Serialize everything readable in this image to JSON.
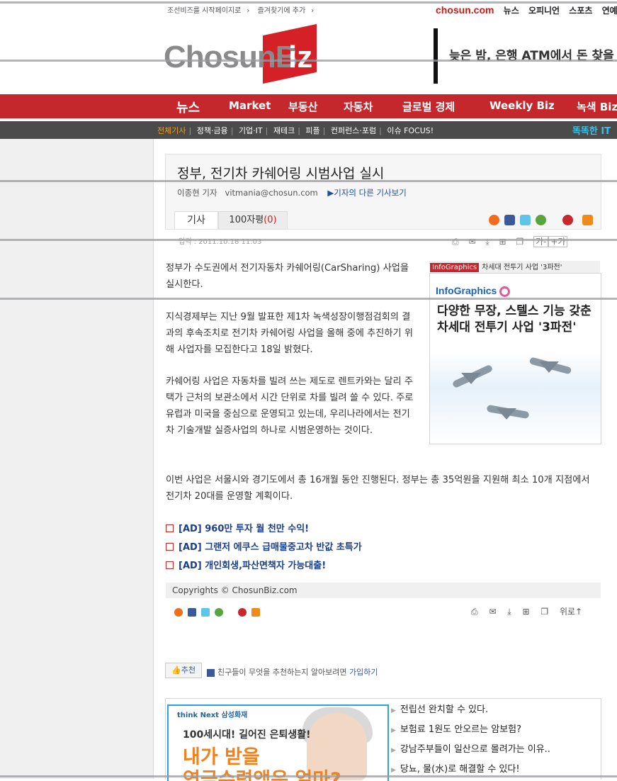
{
  "util": {
    "set_home": "조선비즈를 시작페이지로",
    "bookmark": "즐겨찾기에 추가"
  },
  "topnav": {
    "brand": "chosun.com",
    "items": [
      "뉴스",
      "오피니언",
      "스포츠",
      "연예"
    ]
  },
  "logo": {
    "left": "ChosunB",
    "right": "iz"
  },
  "ticker": {
    "text": "늦은 밤, 은행 ATM에서 돈 찾을"
  },
  "mainnav": {
    "items": [
      "뉴스",
      "Market",
      "부동산",
      "자동차",
      "글로벌 경제",
      "Weekly Biz",
      "녹색 Biz"
    ]
  },
  "subnav": {
    "items": [
      "전체기사",
      "정책·금융",
      "기업·IT",
      "재테크",
      "피플",
      "컨퍼런스·포럼",
      "이슈 FOCUS!"
    ],
    "right": "똑똑한 IT"
  },
  "article": {
    "headline": "정부, 전기차 카쉐어링 시범사업 실시",
    "author": "이종현 기자",
    "email": "vitmania@chosun.com",
    "more_link": "▶기자의 다른 기사보기",
    "tab_article": "기사",
    "tab_comments": "100자평",
    "comment_count": "(0)",
    "dateline": "입력 : 2011.10.18 11:03",
    "font_minus": "가-",
    "font_plus": "+가",
    "para1": "정부가 수도권에서 전기자동차 카쉐어링(CarSharing) 사업을 실시한다.",
    "para2": "지식경제부는 지난 9월 발표한 제1차 녹색성장이행점검회의 결과의 후속조치로 전기차 카쉐어링 사업을 올해 중에 추진하기 위해 사업자를 모집한다고 18일 밝혔다.",
    "para3": "카쉐어링 사업은 자동차를 빌려 쓰는 제도로 렌트카와는 달리 주택가 근처의 보관소에서 시간 단위로 차를 빌려 쓸 수 있다. 주로 유럽과 미국을 중심으로 운영되고 있는데, 우리나라에서는 전기차 기술개발 실증사업의 하나로 시범운영하는 것이다.",
    "para4": "이번 사업은 서울시와 경기도에서 총 16개월 동안 진행된다. 정부는 총 35억원을 지원해 최소 10개 지점에서 전기차 20대를 운영할 계획이다."
  },
  "infographic": {
    "tag": "InfoGraphics",
    "label": "차세대 전투기 사업 '3파전'",
    "brand": "InfoGraphics",
    "title": "다양한 무장, 스텔스 기능 갖춘 차세대 전투기 사업 '3파전'"
  },
  "ads": [
    "[AD] 960만 투자 월 천만 수익!",
    "[AD] 그랜저 에쿠스 급매물중고차 반값 초특가",
    "[AD] 개인회생,파산면책자 가능대출!"
  ],
  "copyright": "Copyrights © ChosunBiz.com",
  "bottom_tools": {
    "top_link": "위로↑"
  },
  "facebook": {
    "like": "추천",
    "text": "친구들이 무엇을 추천하는지 알아보려면",
    "join": "가입하기"
  },
  "bottom_ad": {
    "brand": "think Next 삼성화재",
    "line1": "100세시대! 길어진 은퇴생활!",
    "line2": "내가 받을",
    "line3": "연금수령액은 얼마?",
    "links": [
      "전립선 완치할 수 있다.",
      "보험료 1원도 안오르는 암보험?",
      "강남주부들이 일산으로 몰려가는 이유..",
      "당뇨, 물(水)로 해결할 수 있다!"
    ]
  },
  "colors": {
    "nav_red": "#c4282c",
    "subnav_gray": "#4b4b4b",
    "active_orange": "#f0a020",
    "link_blue": "#1c4ea0"
  }
}
